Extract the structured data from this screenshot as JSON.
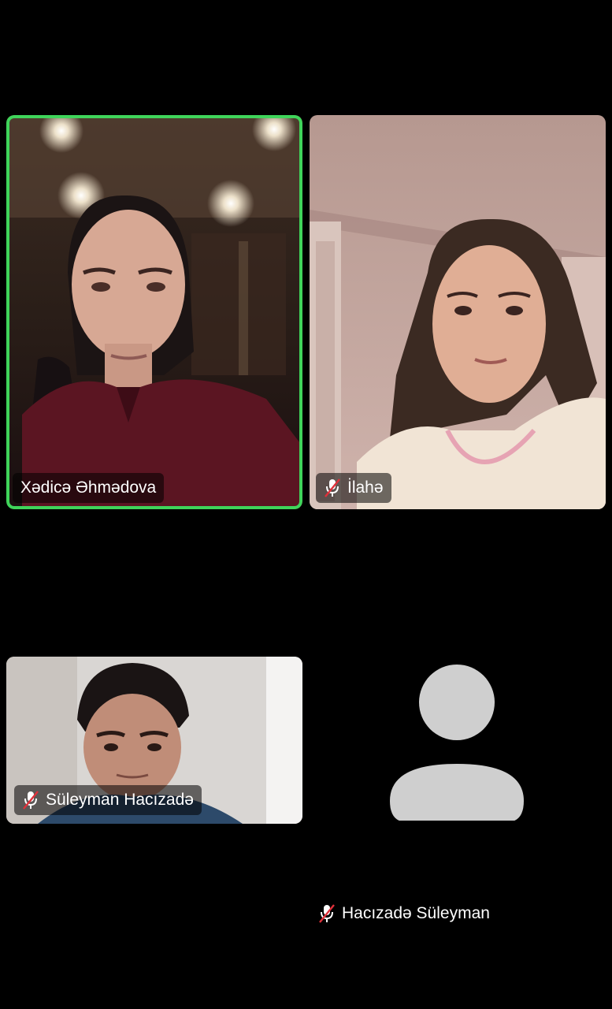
{
  "participants": [
    {
      "name": "Xədicə Əhmədova",
      "muted": false,
      "active_speaker": true,
      "video": true
    },
    {
      "name": "İlahə",
      "muted": true,
      "active_speaker": false,
      "video": true
    },
    {
      "name": "Süleyman Hacızadə",
      "muted": true,
      "active_speaker": false,
      "video": true
    },
    {
      "name": "Hacızadə Süleyman",
      "muted": true,
      "active_speaker": false,
      "video": false
    }
  ],
  "colors": {
    "background": "#000000",
    "active_border": "#3fd45a",
    "muted_slash": "#e0303a",
    "avatar_gray": "#cfcfcf"
  },
  "icons": {
    "muted_mic": "mic-muted-icon",
    "avatar": "avatar-placeholder-icon"
  }
}
